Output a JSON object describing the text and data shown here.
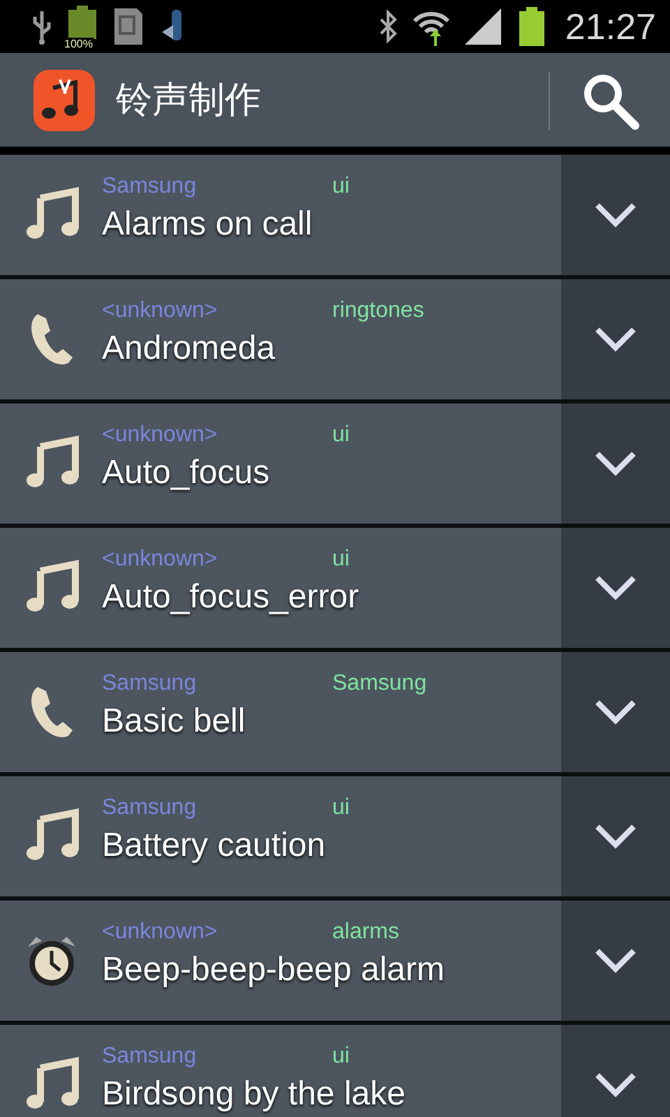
{
  "status_bar": {
    "battery_label": "100%",
    "time": "21:27"
  },
  "action_bar": {
    "title": "铃声制作"
  },
  "ringtones": [
    {
      "kind": "music",
      "artist": "Samsung",
      "category": "ui",
      "title": "Alarms on call"
    },
    {
      "kind": "phone",
      "artist": "<unknown>",
      "category": "ringtones",
      "title": "Andromeda"
    },
    {
      "kind": "music",
      "artist": "<unknown>",
      "category": "ui",
      "title": "Auto_focus"
    },
    {
      "kind": "music",
      "artist": "<unknown>",
      "category": "ui",
      "title": "Auto_focus_error"
    },
    {
      "kind": "phone",
      "artist": "Samsung",
      "category": "Samsung",
      "title": "Basic bell"
    },
    {
      "kind": "music",
      "artist": "Samsung",
      "category": "ui",
      "title": "Battery caution"
    },
    {
      "kind": "alarm",
      "artist": "<unknown>",
      "category": "alarms",
      "title": "Beep-beep-beep alarm"
    },
    {
      "kind": "music",
      "artist": "Samsung",
      "category": "ui",
      "title": "Birdsong by the lake"
    }
  ]
}
